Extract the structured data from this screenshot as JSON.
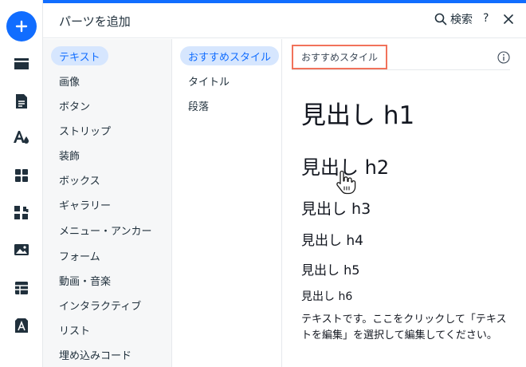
{
  "panel": {
    "title": "パーツを追加",
    "search_label": "検索",
    "help_label": "?"
  },
  "left_rail": {
    "icons": [
      "add-icon",
      "menu-strip-icon",
      "page-icon",
      "design-icon",
      "apps-icon",
      "puzzle-icon",
      "media-icon",
      "table-icon",
      "text-box-icon"
    ]
  },
  "categories": [
    {
      "label": "テキスト",
      "selected": true
    },
    {
      "label": "画像"
    },
    {
      "label": "ボタン"
    },
    {
      "label": "ストリップ"
    },
    {
      "label": "装飾"
    },
    {
      "label": "ボックス"
    },
    {
      "label": "ギャラリー"
    },
    {
      "label": "メニュー・アンカー"
    },
    {
      "label": "フォーム"
    },
    {
      "label": "動画・音楽"
    },
    {
      "label": "インタラクティブ"
    },
    {
      "label": "リスト"
    },
    {
      "label": "埋め込みコード"
    }
  ],
  "subcategories": [
    {
      "label": "おすすめスタイル",
      "selected": true
    },
    {
      "label": "タイトル"
    },
    {
      "label": "段落"
    }
  ],
  "content": {
    "section_label": "おすすめスタイル",
    "presets": {
      "h1": "見出し h1",
      "h2": "見出し h2",
      "h3": "見出し h3",
      "h4": "見出し h4",
      "h5": "見出し h5",
      "h6": "見出し h6",
      "paragraph": "テキストです。ここをクリックして「テキストを編集」を選択して編集してください。"
    }
  },
  "colors": {
    "accent": "#116dff",
    "selected_bg": "#d6e6fe",
    "highlight_border": "#f1725a"
  }
}
